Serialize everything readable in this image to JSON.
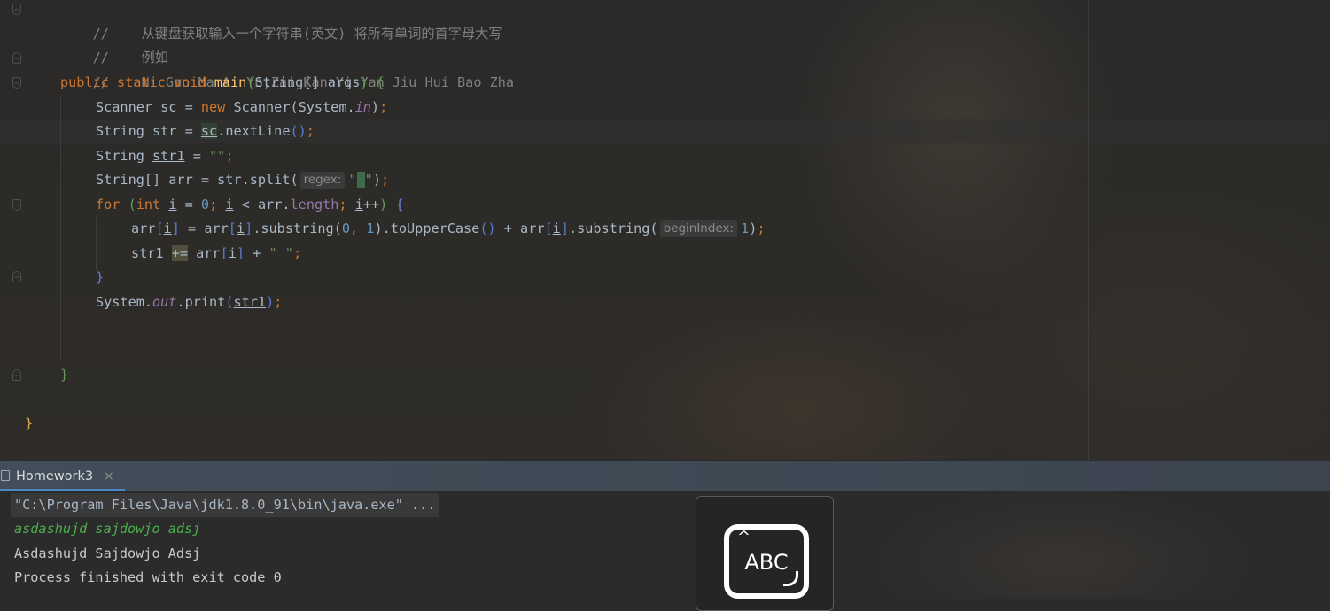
{
  "editor": {
    "lines": {
      "l1": {
        "comment": "//    从键盘获取输入一个字符串(英文) 将所有单词的首字母大写"
      },
      "l2": {
        "comment": "//    例如"
      },
      "l3": {
        "comment": "//    Ni Gan Ma Ai Yo,Zai Kan Yi Yan Jiu Hui Bao Zha"
      },
      "l4": {
        "kw": "public static void ",
        "fn": "main",
        "p1": "(",
        "t": "String",
        "b": "[] args",
        "p2": ")",
        "brace": " {"
      },
      "l5": {
        "a": "Scanner sc = ",
        "kw": "new",
        "b": " Scanner(System.",
        "field": "in",
        "c": ")",
        "semi": ";"
      },
      "l6": {
        "a": "String str = ",
        "var": "sc",
        "b": ".nextLine",
        "paren": "()",
        "semi": ";"
      },
      "l7": {
        "a": "String ",
        "var": "str1",
        "b": " = ",
        "str": "\"\"",
        "semi": ";"
      },
      "l8": {
        "a": "String[] arr = str.split(",
        "hint": "regex:",
        "q1": "\"",
        "sp": " ",
        "q2": "\"",
        "c": ")",
        "semi": ";"
      },
      "l9": {
        "kw1": "for ",
        "p1": "(",
        "kw2": "int ",
        "i1": "i",
        "eq": " = ",
        "n0": "0",
        "s1": "; ",
        "i2": "i",
        "lt": " < ",
        "arr": "arr.",
        "len": "length",
        "s2": "; ",
        "i3": "i",
        "pp": "++",
        "p2": ")",
        "brace": " {"
      },
      "l10": {
        "a": "arr",
        "br1": "[",
        "i1": "i",
        "br2": "]",
        "b": " = arr",
        "br3": "[",
        "i2": "i",
        "br4": "]",
        "c": ".substring(",
        "n0": "0",
        "cm": ", ",
        "n1": "1",
        "d": ").toUpperCase",
        "paren": "()",
        "e": " + arr",
        "br5": "[",
        "i3": "i",
        "br6": "]",
        "f": ".substring(",
        "hint": "beginIndex:",
        "n2": "1",
        "g": ")",
        "semi": ";"
      },
      "l11": {
        "var": "str1",
        "sp": " ",
        "op": "+=",
        "b": " arr",
        "br1": "[",
        "i": "i",
        "br2": "]",
        "c": " + ",
        "str": "\" \"",
        "semi": ";"
      },
      "l12": {
        "brace": "}"
      },
      "l13": {
        "a": "System.",
        "field": "out",
        "b": ".print",
        "p1": "(",
        "var": "str1",
        "p2": ")",
        "semi": ";"
      },
      "l14": {
        "brace": "}"
      },
      "l15": {
        "brace": "}"
      }
    },
    "fold_glyph": "−"
  },
  "run_panel": {
    "tab_label": "Homework3",
    "close_glyph": "×",
    "console": {
      "command": "\"C:\\Program Files\\Java\\jdk1.8.0_91\\bin\\java.exe\" ...",
      "user_input": "asdashujd sajdowjo adsj",
      "output": "Asdashujd Sajdowjo Adsj",
      "exit": "Process finished with exit code 0"
    }
  },
  "ime_indicator": {
    "label": "ABC",
    "caret_glyph": "^",
    "icon": "abc-input-method-icon"
  }
}
